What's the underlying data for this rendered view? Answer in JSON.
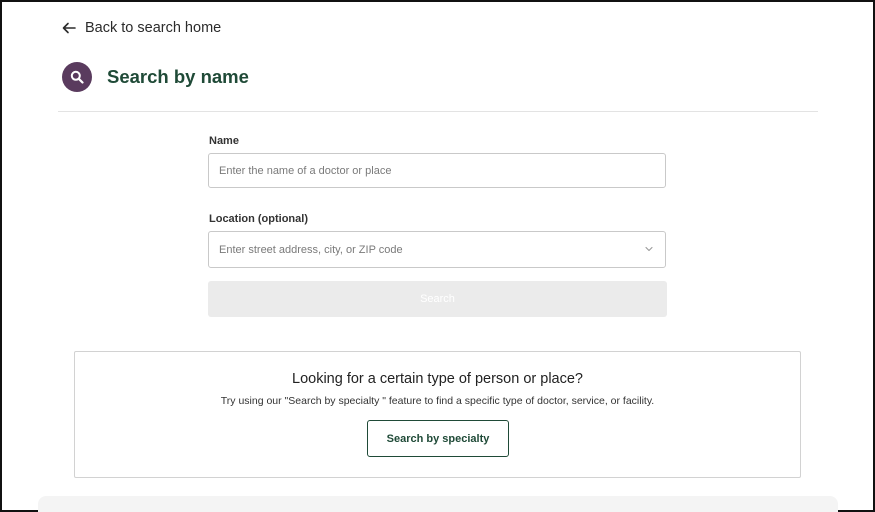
{
  "nav": {
    "back_label": "Back to search home"
  },
  "header": {
    "title": "Search by name"
  },
  "form": {
    "name_label": "Name",
    "name_placeholder": "Enter the name of a doctor or place",
    "name_value": "",
    "location_label": "Location (optional)",
    "location_placeholder": "Enter street address, city, or ZIP code",
    "location_value": "",
    "search_label": "Search"
  },
  "specialty_card": {
    "heading": "Looking for a certain type of person or place?",
    "text": "Try using our \"Search by specialty \" feature to find a specific type of doctor, service, or facility.",
    "button_label": "Search by specialty"
  },
  "colors": {
    "brand_green": "#1f4a37",
    "icon_purple": "#5a3b5e",
    "disabled_button": "#ebebeb"
  },
  "icons": {
    "back": "arrow-left-icon",
    "title": "search-icon",
    "location_dropdown": "chevron-down-icon"
  }
}
